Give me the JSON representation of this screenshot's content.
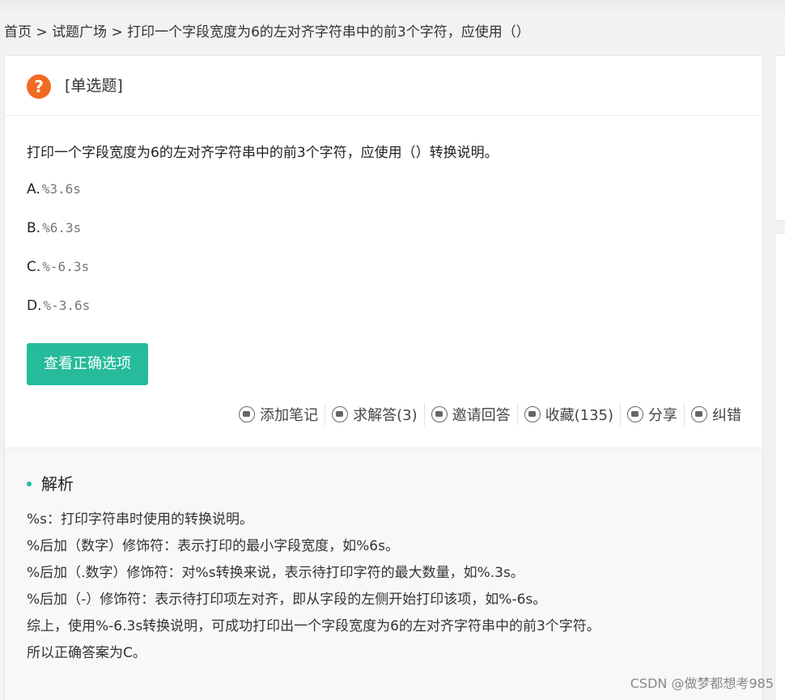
{
  "breadcrumb": "首页 > 试题广场 > 打印一个字段宽度为6的左对齐字符串中的前3个字符，应使用（）",
  "question_type": "[单选题]",
  "question_icon": "question-circle-icon",
  "question_text": "打印一个字段宽度为6的左对齐字符串中的前3个字符，应使用（）转换说明。",
  "options": [
    {
      "letter": "A.",
      "code": "%3.6s"
    },
    {
      "letter": "B.",
      "code": "%6.3s"
    },
    {
      "letter": "C.",
      "code": "%-6.3s"
    },
    {
      "letter": "D.",
      "code": "%-3.6s"
    }
  ],
  "show_answer_button": "查看正确选项",
  "actions": [
    {
      "icon": "book-icon",
      "label": "添加笔记"
    },
    {
      "icon": "chat-bubble-icon",
      "label": "求解答(3)"
    },
    {
      "icon": "megaphone-icon",
      "label": "邀请回答"
    },
    {
      "icon": "heart-icon",
      "label": "收藏(135)"
    },
    {
      "icon": "share-icon",
      "label": "分享"
    },
    {
      "icon": "pencil-icon",
      "label": "纠错"
    }
  ],
  "analysis": {
    "title": "解析",
    "lines": [
      "%s：打印字符串时使用的转换说明。",
      "%后加（数字）修饰符：表示打印的最小字段宽度，如%6s。",
      "%后加（.数字）修饰符：对%s转换来说，表示待打印字符的最大数量，如%.3s。",
      "%后加（-）修饰符：表示待打印项左对齐，即从字段的左侧开始打印该项，如%-6s。",
      "综上，使用%-6.3s转换说明，可成功打印出一个字段宽度为6的左对齐字符串中的前3个字符。",
      "所以正确答案为C。"
    ]
  },
  "watermark": "CSDN @做梦都想考985",
  "colors": {
    "accent": "#25bb9b",
    "question_icon": "#f26b24"
  }
}
